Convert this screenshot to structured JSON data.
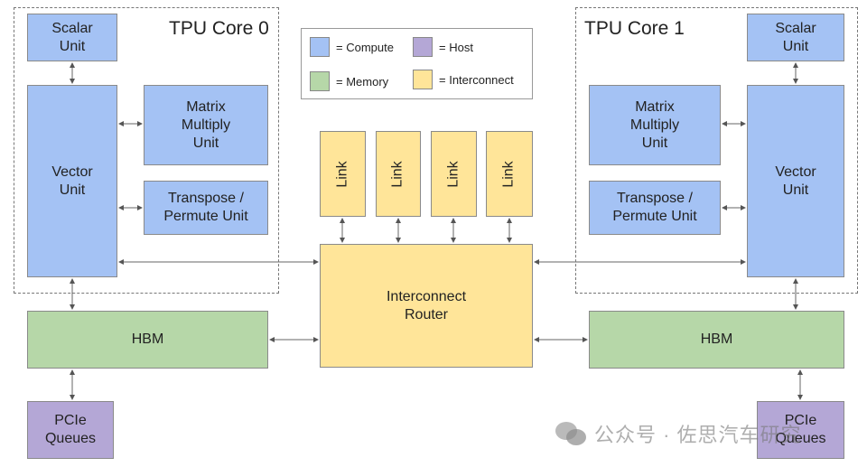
{
  "legend": {
    "compute": "= Compute",
    "host": "= Host",
    "memory": "= Memory",
    "interconnect": "= Interconnect"
  },
  "colors": {
    "compute": "#a4c2f4",
    "memory": "#b6d7a8",
    "interconnect": "#ffe599",
    "host": "#b4a7d6"
  },
  "core0": {
    "title": "TPU Core 0",
    "scalar": "Scalar\nUnit",
    "vector": "Vector\nUnit",
    "matrix": "Matrix\nMultiply\nUnit",
    "transpose": "Transpose /\nPermute Unit"
  },
  "core1": {
    "title": "TPU Core 1",
    "scalar": "Scalar\nUnit",
    "vector": "Vector\nUnit",
    "matrix": "Matrix\nMultiply\nUnit",
    "transpose": "Transpose /\nPermute Unit"
  },
  "links": [
    "Link",
    "Link",
    "Link",
    "Link"
  ],
  "router": "Interconnect\nRouter",
  "hbm_left": "HBM",
  "hbm_right": "HBM",
  "pcie_left": "PCIe\nQueues",
  "pcie_right": "PCIe\nQueues",
  "watermark": "公众号 · 佐思汽车研究"
}
